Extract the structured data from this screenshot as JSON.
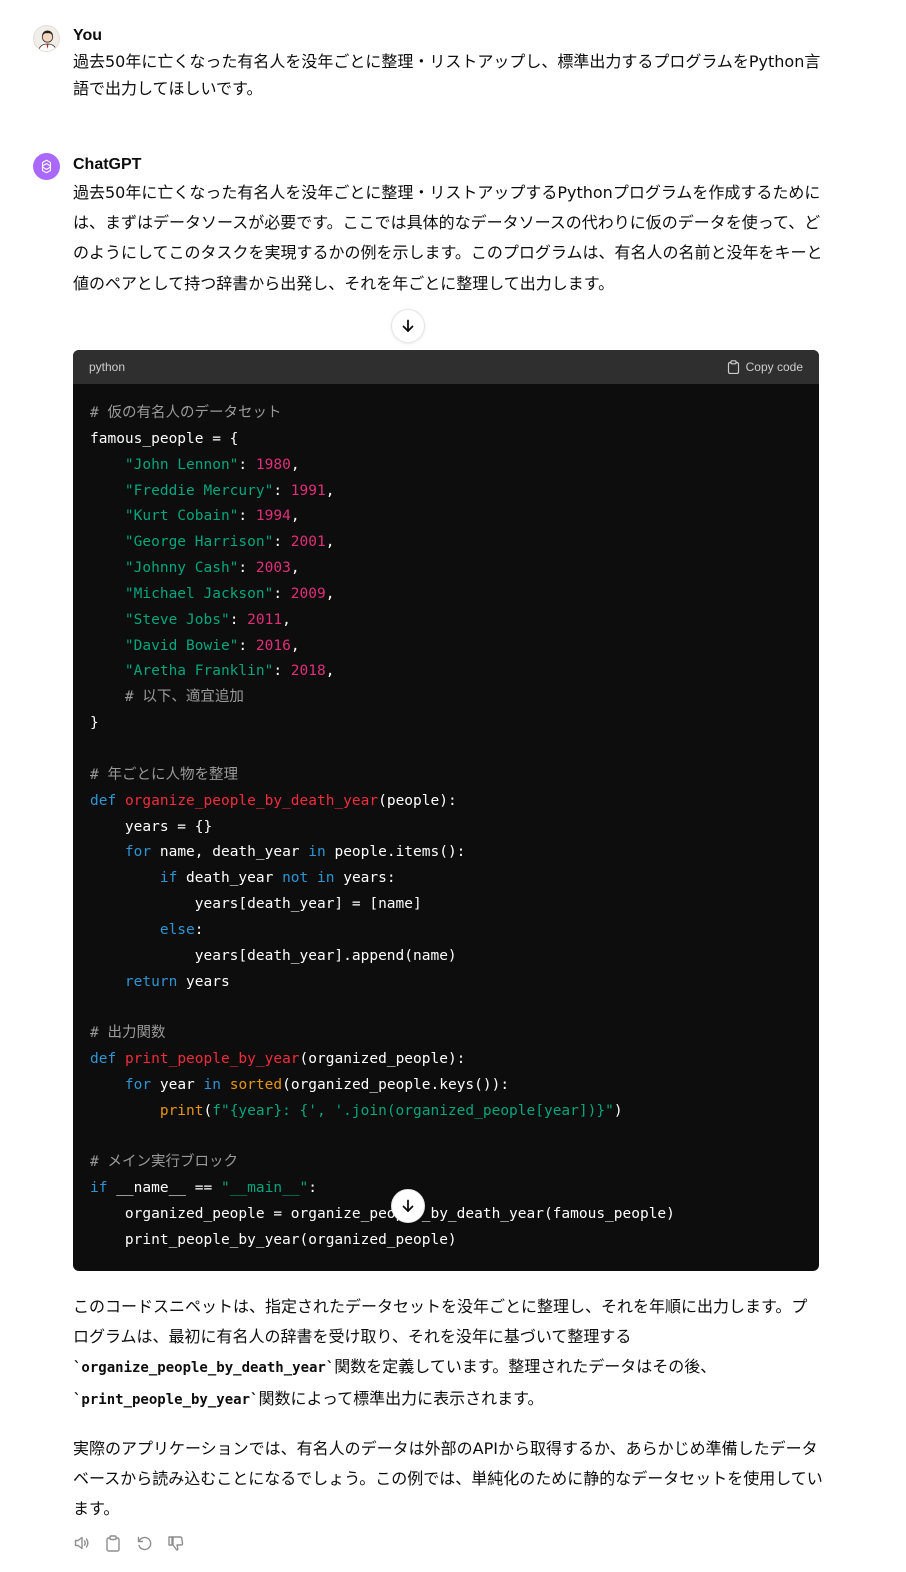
{
  "user_message": {
    "author": "You",
    "text": "過去50年に亡くなった有名人を没年ごとに整理・リストアップし、標準出力するプログラムをPython言語で出力してほしいです。"
  },
  "assistant_message": {
    "author": "ChatGPT",
    "intro": "過去50年に亡くなった有名人を没年ごとに整理・リストアップするPythonプログラムを作成するためには、まずはデータソースが必要です。ここでは具体的なデータソースの代わりに仮のデータを使って、どのようにしてこのタスクを実現するかの例を示します。このプログラムは、有名人の名前と没年をキーと値のペアとして持つ辞書から出発し、それを年ごとに整理して出力します。",
    "code_block": {
      "language": "python",
      "copy_label": "Copy code",
      "lines": [
        [
          {
            "c": "comment",
            "t": "# 仮の有名人のデータセット"
          }
        ],
        [
          {
            "c": "plain",
            "t": "famous_people = {"
          }
        ],
        [
          {
            "c": "plain",
            "t": "    "
          },
          {
            "c": "string",
            "t": "\"John Lennon\""
          },
          {
            "c": "plain",
            "t": ": "
          },
          {
            "c": "number",
            "t": "1980"
          },
          {
            "c": "plain",
            "t": ","
          }
        ],
        [
          {
            "c": "plain",
            "t": "    "
          },
          {
            "c": "string",
            "t": "\"Freddie Mercury\""
          },
          {
            "c": "plain",
            "t": ": "
          },
          {
            "c": "number",
            "t": "1991"
          },
          {
            "c": "plain",
            "t": ","
          }
        ],
        [
          {
            "c": "plain",
            "t": "    "
          },
          {
            "c": "string",
            "t": "\"Kurt Cobain\""
          },
          {
            "c": "plain",
            "t": ": "
          },
          {
            "c": "number",
            "t": "1994"
          },
          {
            "c": "plain",
            "t": ","
          }
        ],
        [
          {
            "c": "plain",
            "t": "    "
          },
          {
            "c": "string",
            "t": "\"George Harrison\""
          },
          {
            "c": "plain",
            "t": ": "
          },
          {
            "c": "number",
            "t": "2001"
          },
          {
            "c": "plain",
            "t": ","
          }
        ],
        [
          {
            "c": "plain",
            "t": "    "
          },
          {
            "c": "string",
            "t": "\"Johnny Cash\""
          },
          {
            "c": "plain",
            "t": ": "
          },
          {
            "c": "number",
            "t": "2003"
          },
          {
            "c": "plain",
            "t": ","
          }
        ],
        [
          {
            "c": "plain",
            "t": "    "
          },
          {
            "c": "string",
            "t": "\"Michael Jackson\""
          },
          {
            "c": "plain",
            "t": ": "
          },
          {
            "c": "number",
            "t": "2009"
          },
          {
            "c": "plain",
            "t": ","
          }
        ],
        [
          {
            "c": "plain",
            "t": "    "
          },
          {
            "c": "string",
            "t": "\"Steve Jobs\""
          },
          {
            "c": "plain",
            "t": ": "
          },
          {
            "c": "number",
            "t": "2011"
          },
          {
            "c": "plain",
            "t": ","
          }
        ],
        [
          {
            "c": "plain",
            "t": "    "
          },
          {
            "c": "string",
            "t": "\"David Bowie\""
          },
          {
            "c": "plain",
            "t": ": "
          },
          {
            "c": "number",
            "t": "2016"
          },
          {
            "c": "plain",
            "t": ","
          }
        ],
        [
          {
            "c": "plain",
            "t": "    "
          },
          {
            "c": "string",
            "t": "\"Aretha Franklin\""
          },
          {
            "c": "plain",
            "t": ": "
          },
          {
            "c": "number",
            "t": "2018"
          },
          {
            "c": "plain",
            "t": ","
          }
        ],
        [
          {
            "c": "plain",
            "t": "    "
          },
          {
            "c": "comment",
            "t": "# 以下、適宜追加"
          }
        ],
        [
          {
            "c": "plain",
            "t": "}"
          }
        ],
        [],
        [
          {
            "c": "comment",
            "t": "# 年ごとに人物を整理"
          }
        ],
        [
          {
            "c": "keyword",
            "t": "def"
          },
          {
            "c": "plain",
            "t": " "
          },
          {
            "c": "function",
            "t": "organize_people_by_death_year"
          },
          {
            "c": "plain",
            "t": "(people):"
          }
        ],
        [
          {
            "c": "plain",
            "t": "    years = {}"
          }
        ],
        [
          {
            "c": "plain",
            "t": "    "
          },
          {
            "c": "keyword",
            "t": "for"
          },
          {
            "c": "plain",
            "t": " name, death_year "
          },
          {
            "c": "keyword",
            "t": "in"
          },
          {
            "c": "plain",
            "t": " people.items():"
          }
        ],
        [
          {
            "c": "plain",
            "t": "        "
          },
          {
            "c": "keyword",
            "t": "if"
          },
          {
            "c": "plain",
            "t": " death_year "
          },
          {
            "c": "keyword",
            "t": "not"
          },
          {
            "c": "plain",
            "t": " "
          },
          {
            "c": "keyword",
            "t": "in"
          },
          {
            "c": "plain",
            "t": " years:"
          }
        ],
        [
          {
            "c": "plain",
            "t": "            years[death_year] = [name]"
          }
        ],
        [
          {
            "c": "plain",
            "t": "        "
          },
          {
            "c": "keyword",
            "t": "else"
          },
          {
            "c": "plain",
            "t": ":"
          }
        ],
        [
          {
            "c": "plain",
            "t": "            years[death_year].append(name)"
          }
        ],
        [
          {
            "c": "plain",
            "t": "    "
          },
          {
            "c": "keyword",
            "t": "return"
          },
          {
            "c": "plain",
            "t": " years"
          }
        ],
        [],
        [
          {
            "c": "comment",
            "t": "# 出力関数"
          }
        ],
        [
          {
            "c": "keyword",
            "t": "def"
          },
          {
            "c": "plain",
            "t": " "
          },
          {
            "c": "function",
            "t": "print_people_by_year"
          },
          {
            "c": "plain",
            "t": "(organized_people):"
          }
        ],
        [
          {
            "c": "plain",
            "t": "    "
          },
          {
            "c": "keyword",
            "t": "for"
          },
          {
            "c": "plain",
            "t": " year "
          },
          {
            "c": "keyword",
            "t": "in"
          },
          {
            "c": "plain",
            "t": " "
          },
          {
            "c": "builtin",
            "t": "sorted"
          },
          {
            "c": "plain",
            "t": "(organized_people.keys()):"
          }
        ],
        [
          {
            "c": "plain",
            "t": "        "
          },
          {
            "c": "builtin",
            "t": "print"
          },
          {
            "c": "plain",
            "t": "("
          },
          {
            "c": "string",
            "t": "f\"{year}: {', '.join(organized_people[year])}\""
          },
          {
            "c": "plain",
            "t": ")"
          }
        ],
        [],
        [
          {
            "c": "comment",
            "t": "# メイン実行ブロック"
          }
        ],
        [
          {
            "c": "keyword",
            "t": "if"
          },
          {
            "c": "plain",
            "t": " __name__ == "
          },
          {
            "c": "string",
            "t": "\"__main__\""
          },
          {
            "c": "plain",
            "t": ":"
          }
        ],
        [
          {
            "c": "plain",
            "t": "    organized_people = organize_people_by_death_year(famous_people)"
          }
        ],
        [
          {
            "c": "plain",
            "t": "    print_people_by_year(organized_people)"
          }
        ]
      ]
    },
    "after_p1": {
      "s1": "このコードスニペットは、指定されたデータセットを没年ごとに整理し、それを年順に出力します。プログラムは、最初に有名人の辞書を受け取り、それを没年に基づいて整理する",
      "code1": "`organize_people_by_death_year`",
      "s2": "関数を定義しています。整理されたデータはその後、",
      "code2": "`print_people_by_year`",
      "s3": "関数によって標準出力に表示されます。"
    },
    "after_p2": "実際のアプリケーションでは、有名人のデータは外部のAPIから取得するか、あらかじめ準備したデータベースから読み込むことになるでしょう。この例では、単純化のために静的なデータセットを使用しています。"
  },
  "icons": {
    "user_avatar": "user-avatar",
    "gpt_avatar": "openai-logo-icon",
    "scroll": "arrow-down-icon",
    "copy": "clipboard-icon",
    "actions": [
      "speaker-icon",
      "clipboard-icon",
      "regenerate-icon",
      "thumbs-down-icon"
    ]
  },
  "colors": {
    "gpt_avatar_bg": "#ab68ff",
    "code_bg": "#0d0d0d",
    "code_header_bg": "#2f2f2f",
    "comment": "#9a9a9a",
    "keyword": "#2e95d3",
    "string": "#00a67d",
    "number": "#df3079",
    "function": "#f22c3d",
    "builtin": "#e9950c"
  }
}
